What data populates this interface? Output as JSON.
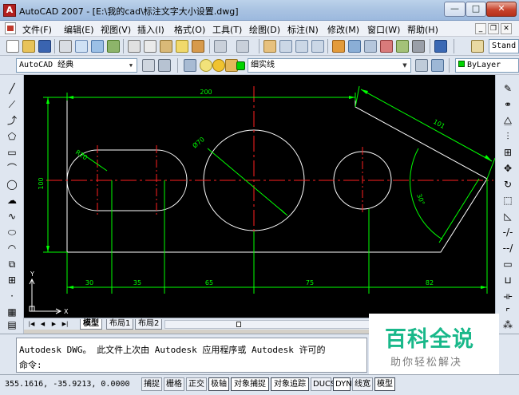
{
  "window": {
    "title": "AutoCAD 2007 - [E:\\我的cad\\标注文字大小设置.dwg]",
    "app_icon_letter": "A",
    "min_glyph": "—",
    "max_glyph": "□",
    "close_glyph": "✕"
  },
  "menu": {
    "items": [
      "文件(F)",
      "编辑(E)",
      "视图(V)",
      "插入(I)",
      "格式(O)",
      "工具(T)",
      "绘图(D)",
      "标注(N)",
      "修改(M)",
      "窗口(W)",
      "帮助(H)"
    ],
    "mdi_buttons": [
      "_",
      "❐",
      "✕"
    ]
  },
  "toolbar": {
    "text_style_value": "Stand",
    "workspace_value": "AutoCAD 经典",
    "layer_value": "细实线",
    "color_value": "ByLayer"
  },
  "drawing": {
    "dims": {
      "top": "200",
      "slant": "101",
      "left": "100",
      "r_slot": "R20",
      "d_circle": "Ø70",
      "angle": "30°",
      "b1": "30",
      "b2": "35",
      "b3": "65",
      "b4": "75",
      "b5": "82"
    },
    "ucs": {
      "x": "X",
      "y": "Y"
    },
    "colors": {
      "background": "#000000",
      "outline": "#ffffff",
      "dimension": "#00ff00",
      "centerline": "#ff2020"
    }
  },
  "tabs": {
    "nav": [
      "|◀",
      "◀",
      "▶",
      "▶|"
    ],
    "items": [
      "模型",
      "布局1",
      "布局2"
    ]
  },
  "command": {
    "line1": "Autodesk DWG。  此文件上次由 Autodesk 应用程序或 Autodesk 许可的",
    "prompt": "命令:"
  },
  "status": {
    "coords": "355.1616, -35.9213, 0.0000",
    "buttons": [
      "捕捉",
      "栅格",
      "正交",
      "极轴",
      "对象捕捉",
      "对象追踪",
      "DUCS",
      "DYN",
      "线宽",
      "模型"
    ]
  },
  "watermark": {
    "title": "百科全说",
    "subtitle": "助你轻松解决"
  }
}
